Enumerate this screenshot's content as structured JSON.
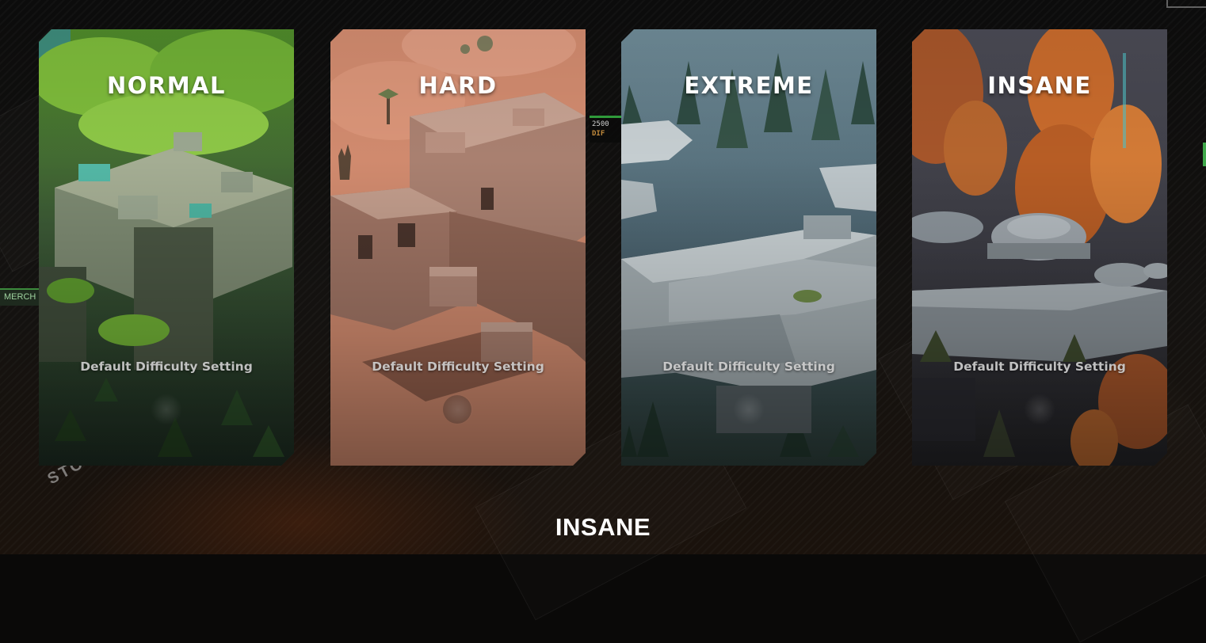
{
  "difficulty_cards": [
    {
      "title": "NORMAL",
      "description": "Default Difficulty Setting",
      "theme": "jungle ruins",
      "accent": "#6fae35"
    },
    {
      "title": "HARD",
      "description": "Default Difficulty Setting",
      "theme": "desert compound",
      "accent": "#d8967c"
    },
    {
      "title": "EXTREME",
      "description": "Default Difficulty Setting",
      "theme": "crashed ships in forest",
      "accent": "#b8c2c8"
    },
    {
      "title": "INSANE",
      "description": "Default Difficulty Setting",
      "theme": "autumn outpost",
      "accent": "#c76a2c"
    }
  ],
  "selected_difficulty": "INSANE",
  "background": {
    "merchant_tag": "MERCH",
    "stop_text": "STOP",
    "score_value": "2500",
    "score_sub": "DIF"
  }
}
